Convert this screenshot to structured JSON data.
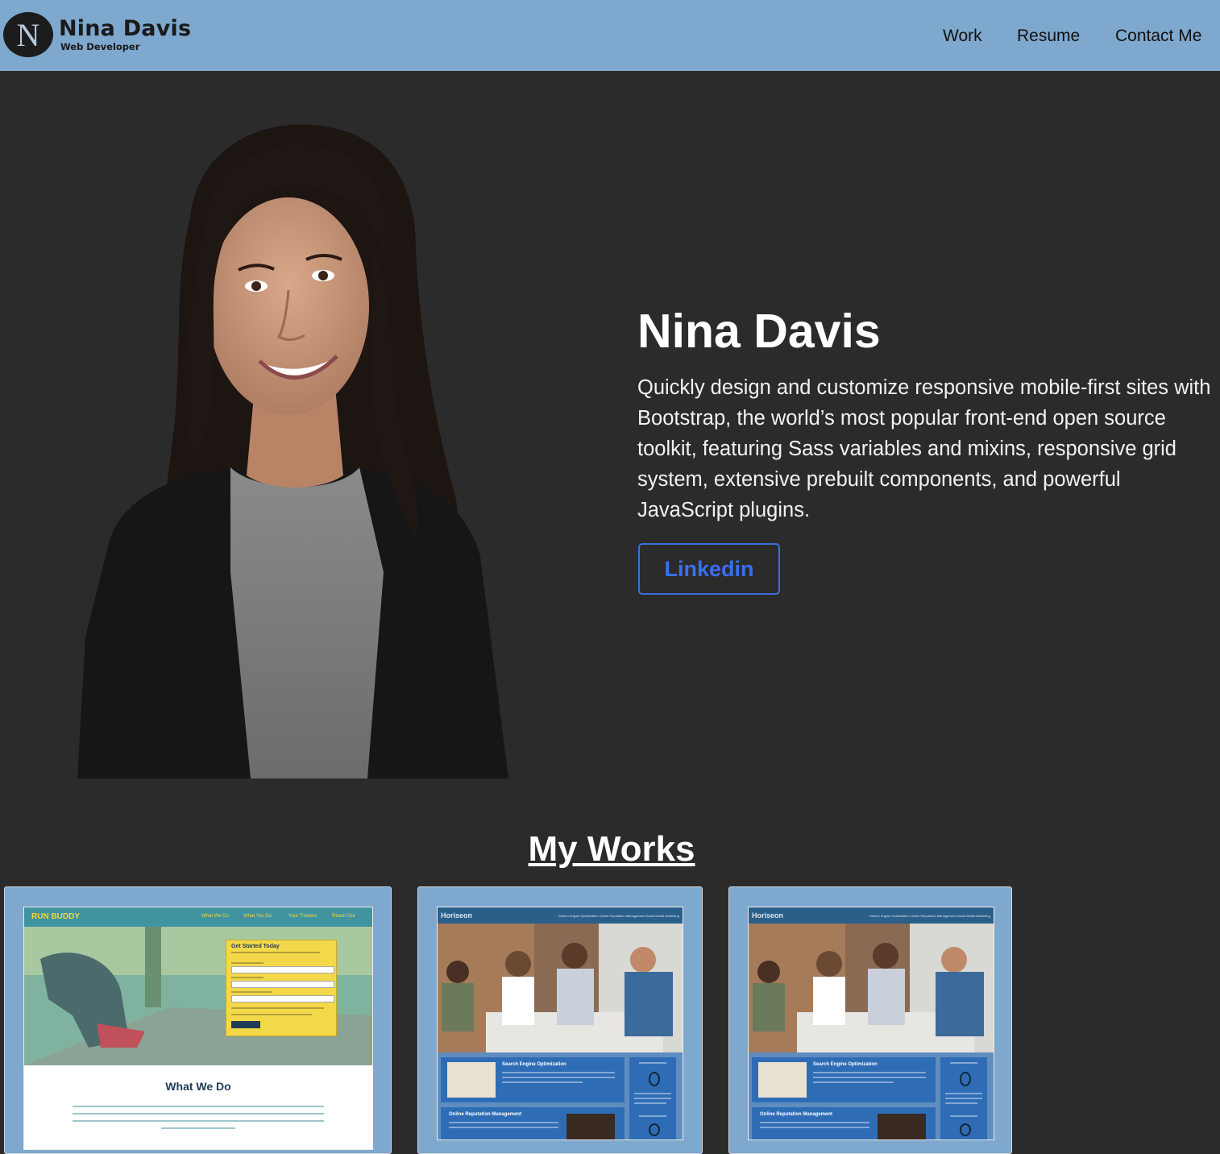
{
  "navbar": {
    "logo_letter": "N",
    "brand_name": "Nina Davis",
    "brand_subtitle": "Web Developer",
    "links": [
      "Work",
      "Resume",
      "Contact Me"
    ]
  },
  "hero": {
    "name": "Nina Davis",
    "description": "Quickly design and customize responsive mobile-first sites with Bootstrap, the world’s most popular front-end open source toolkit, featuring Sass variables and mixins, responsive grid system, extensive prebuilt components, and powerful JavaScript plugins.",
    "button_label": "Linkedin"
  },
  "works": {
    "title": "My Works",
    "projects": [
      {
        "logo": "RUN BUDDY",
        "nav": [
          "What We Do",
          "What You Do",
          "Your Trainers",
          "Reach Out"
        ],
        "form_title": "Get Started Today",
        "section_title": "What We Do"
      },
      {
        "logo": "Horiseon",
        "nav": "Search Engine Optimization   Online Reputation Management   Social Media Marketing",
        "block_titles": [
          "Search Engine Optimization",
          "Online Reputation Management"
        ]
      },
      {
        "logo": "Horiseon",
        "nav": "Search Engine Optimization   Online Reputation Management   Social Media Marketing",
        "block_titles": [
          "Search Engine Optimization",
          "Online Reputation Management"
        ]
      }
    ]
  },
  "colors": {
    "navbar_bg": "#7ea8cd",
    "page_bg": "#2b2b2b",
    "button_accent": "#3a6ff0"
  }
}
